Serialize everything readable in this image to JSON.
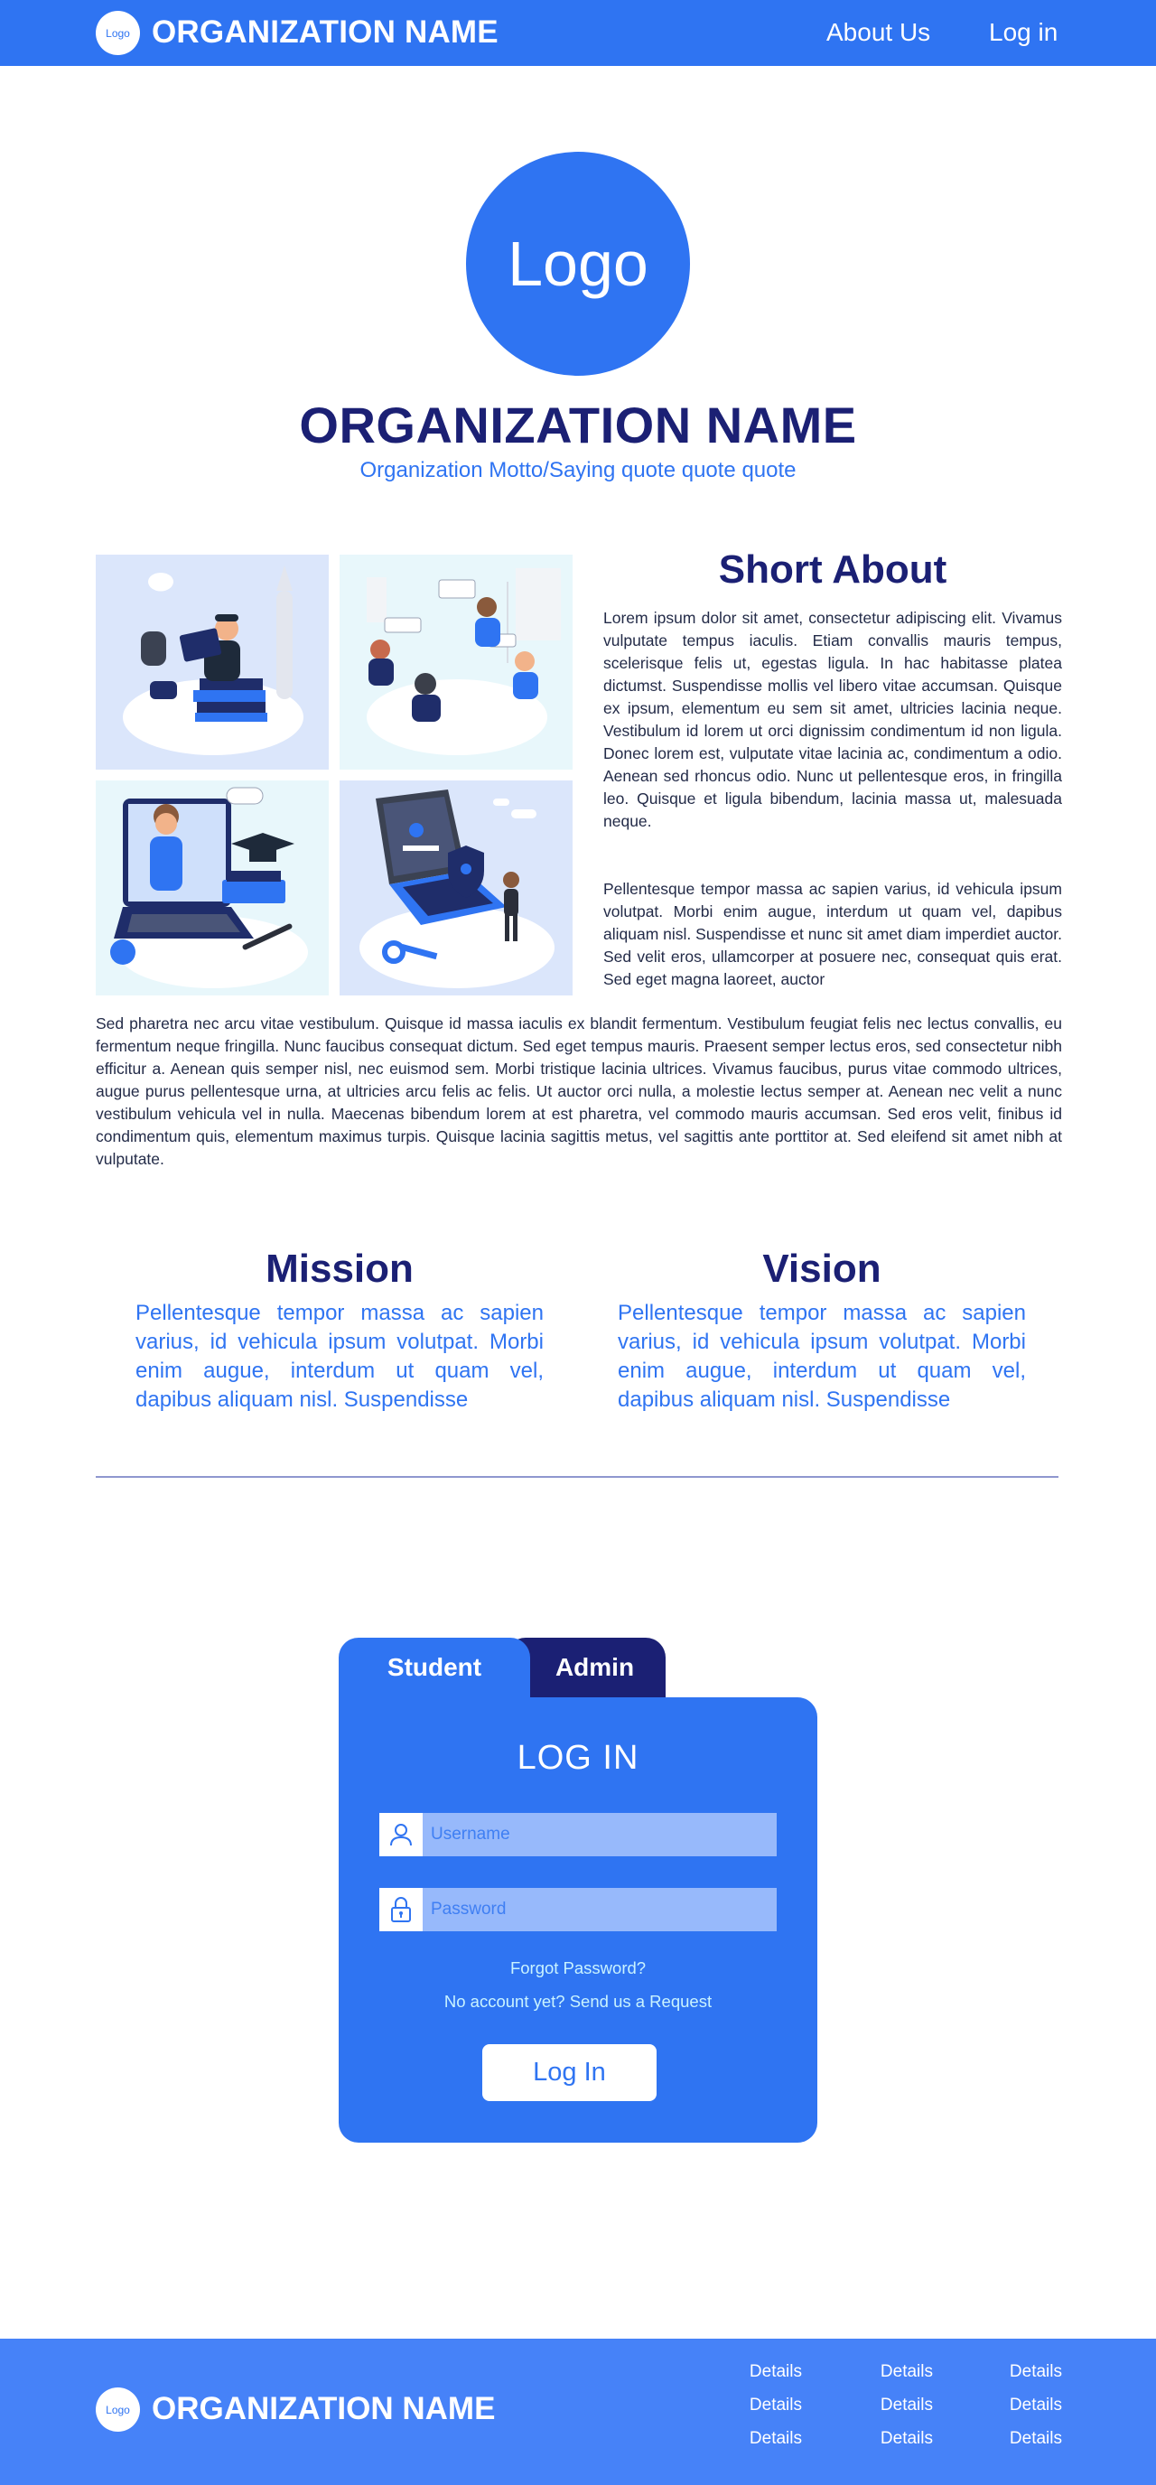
{
  "header": {
    "logo_text": "Logo",
    "org_name": "ORGANIZATION NAME",
    "nav": {
      "about": "About Us",
      "login": "Log in"
    }
  },
  "hero": {
    "logo_text": "Logo",
    "title": "ORGANIZATION NAME",
    "motto": "Organization Motto/Saying quote quote quote"
  },
  "about": {
    "title": "Short About",
    "p1": "Lorem ipsum dolor sit amet, consectetur adipiscing elit. Vivamus vulputate tempus iaculis. Etiam convallis mauris tempus, scelerisque felis ut, egestas ligula. In hac habitasse platea dictumst. Suspendisse mollis vel libero vitae accumsan. Quisque ex ipsum, elementum eu sem sit amet, ultricies lacinia neque. Vestibulum id lorem ut orci dignissim condimentum id non ligula. Donec lorem est, vulputate vitae lacinia ac, condimentum a odio. Aenean sed rhoncus odio. Nunc ut pellentesque eros, in fringilla leo. Quisque et ligula bibendum, lacinia massa ut, malesuada neque.",
    "p2": "Pellentesque tempor massa ac sapien varius, id vehicula ipsum volutpat. Morbi enim augue, interdum ut quam vel, dapibus aliquam nisl. Suspendisse et nunc sit amet diam imperdiet auctor. Sed velit eros, ullamcorper at posuere nec, consequat quis erat. Sed eget magna laoreet, auctor",
    "p3": "Sed pharetra nec arcu vitae vestibulum. Quisque id massa iaculis ex blandit fermentum. Vestibulum feugiat felis nec lectus convallis, eu fermentum neque fringilla. Nunc faucibus consequat dictum. Sed eget tempus mauris. Praesent semper lectus eros, sed consectetur nibh efficitur a. Aenean quis semper nisl, nec euismod sem. Morbi tristique lacinia ultrices. Vivamus faucibus, purus vitae commodo ultrices, augue purus pellentesque urna, at ultricies arcu felis ac felis. Ut auctor orci nulla, a molestie lectus semper at. Aenean nec velit a nunc vestibulum vehicula vel in nulla. Maecenas bibendum lorem at est pharetra, vel commodo mauris accumsan. Sed eros velit, finibus id condimentum quis, elementum maximus turpis. Quisque lacinia sagittis metus, vel sagittis ante porttitor at. Sed eleifend sit amet nibh at vulputate."
  },
  "mission": {
    "title": "Mission",
    "text": "Pellentesque tempor massa ac sapien varius, id vehicula ipsum volutpat. Morbi enim augue, interdum ut quam vel, dapibus aliquam nisl. Suspendisse"
  },
  "vision": {
    "title": "Vision",
    "text": "Pellentesque tempor massa ac sapien varius, id vehicula ipsum volutpat. Morbi enim augue, interdum ut quam vel, dapibus aliquam nisl. Suspendisse"
  },
  "login": {
    "tabs": {
      "student": "Student",
      "admin": "Admin"
    },
    "active_tab": "Student",
    "title": "LOG IN",
    "username_placeholder": "Username",
    "password_placeholder": "Password",
    "forgot": "Forgot Password?",
    "request": "No account yet? Send us a Request",
    "button": "Log In"
  },
  "footer": {
    "logo_text": "Logo",
    "org_name": "ORGANIZATION NAME",
    "details": [
      "Details",
      "Details",
      "Details",
      "Details",
      "Details",
      "Details",
      "Details",
      "Details",
      "Details"
    ]
  },
  "colors": {
    "primary": "#2f74f2",
    "navy": "#1b2074",
    "footer": "#4682f8",
    "field": "#97b9fb",
    "link": "#c9f3ff"
  },
  "icons": [
    "user-icon",
    "lock-icon"
  ]
}
